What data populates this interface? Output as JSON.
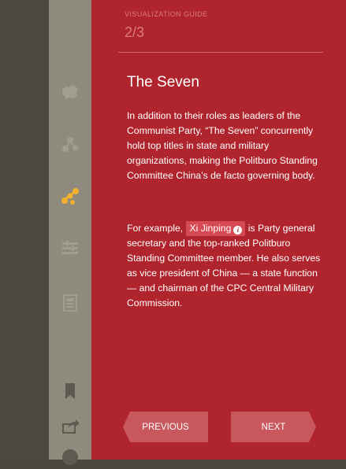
{
  "guide": {
    "label": "VISUALIZATION GUIDE",
    "count": "2/3"
  },
  "content": {
    "title": "The Seven",
    "paragraph1": "In addition to their roles as leaders of the Communist Party, “The Seven” concurrently hold top titles in state and military organizations, making the Politburo Standing Committee China’s de facto governing body.",
    "paragraph2_prefix": "For example, ",
    "highlight_name": "Xi Jinping",
    "paragraph2_suffix": " is Party general secretary and the top-ranked Politburo Standing Committee member. He also serves as vice president of China — a state function — and chairman of the CPC Central Military Commission."
  },
  "navigation": {
    "previous_label": "PREVIOUS",
    "next_label": "NEXT"
  },
  "sidebar": {
    "icons": [
      "china-map-icon",
      "network-icon",
      "hierarchy-icon",
      "timeline-icon",
      "document-icon",
      "bookmark-icon",
      "share-icon",
      "info-icon"
    ],
    "active_icon": "hierarchy-icon"
  },
  "colors": {
    "panel": "#b0252d",
    "rail": "#8d887b",
    "active_icon": "#f1b12d",
    "highlight_chip": "#d64b53",
    "button": "#c8585d"
  }
}
